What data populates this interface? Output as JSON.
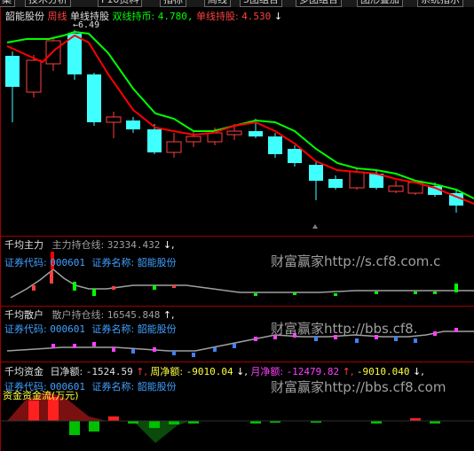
{
  "toolbar": {
    "buttons": [
      "案",
      "技术分析",
      "F10资料",
      "指标",
      "周线",
      "5图组合",
      "多图组合",
      "图形叠加",
      "系统指示"
    ]
  },
  "main_panel": {
    "stock_name": "韶能股份",
    "period": "周线",
    "indicator": "单线持股",
    "dual_label": "双线持币:",
    "dual_value": "4.780,",
    "single_label": "单线持股:",
    "single_value": "4.530",
    "single_arrow": "↓",
    "peak_label": "←6.49"
  },
  "panel_main_force": {
    "title": "千均主力",
    "holding_label": "主力持仓线:",
    "holding_value": "32334.432",
    "arrow": "↓,",
    "code_label": "证券代码:",
    "code": "000601",
    "name_label": "证券名称:",
    "name": "韶能股份",
    "watermark": "财富赢家http://s.cf8.com.c"
  },
  "panel_retail": {
    "title": "千均散户",
    "holding_label": "散户持仓线:",
    "holding_value": "16545.848",
    "arrow": "↑,",
    "code_label": "证券代码:",
    "code": "000601",
    "name_label": "证券名称:",
    "name": "韶能股份",
    "watermark": "财富赢家http://bbs.cf8."
  },
  "panel_funds": {
    "title": "千均资金",
    "day_label": "日净额:",
    "day_value": "-1524.59",
    "day_arrow": "↑,",
    "week_label": "周净额:",
    "week_value": "-9010.04",
    "week_arrow": "↓,",
    "month_label": "月净额:",
    "month_value": "-12479.82",
    "month_arrow": "↑,",
    "extra_value": "-9010.040",
    "extra_arrow": "↓,",
    "code_label": "证券代码:",
    "code": "000601",
    "name_label": "证券名称:",
    "name": "韶能股份",
    "flow_label": "资金资金流(万元)",
    "watermark": "财富赢家http://bbs.cf8.com"
  },
  "colors": {
    "up_candle": "#ff4040",
    "down_candle": "#40ffff",
    "single_line": "#ff0000",
    "dual_line": "#00ff00",
    "divider": "#a00000",
    "label_cyan": "#40a0ff",
    "watermark": "#a0a0a0"
  }
}
